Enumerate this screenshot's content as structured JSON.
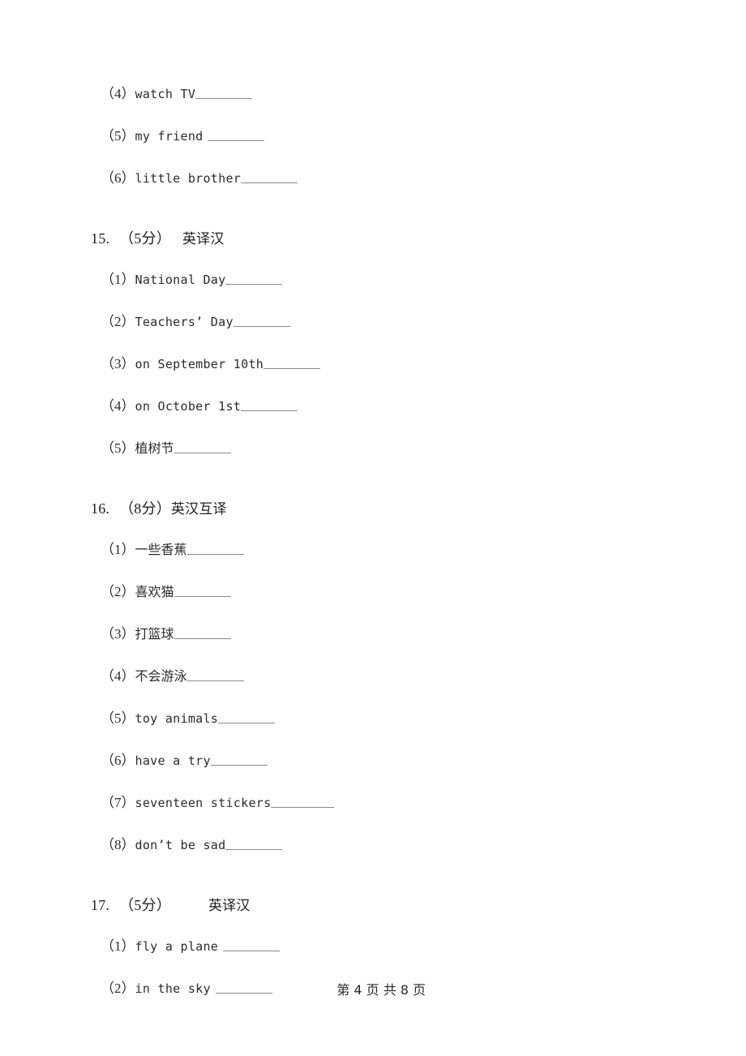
{
  "document": {
    "type": "exam-paper",
    "language": "zh-CN",
    "text_color": "#2b2b2b",
    "blank_color": "#8a8a8a",
    "background": "#ffffff"
  },
  "continued_items": [
    {
      "marker": "（4）",
      "text": "watch TV",
      "space_before_blank": false,
      "blank": "md"
    },
    {
      "marker": "（5）",
      "text": "my friend",
      "space_before_blank": true,
      "blank": "md"
    },
    {
      "marker": "（6）",
      "text": "little brother",
      "space_before_blank": false,
      "blank": "md"
    }
  ],
  "questions": [
    {
      "number": "15.",
      "score": "（5分）",
      "gap": "small",
      "title": "英译汉",
      "items": [
        {
          "marker": "（1）",
          "text": "National Day",
          "script": "en",
          "space_before_blank": false,
          "blank": "md"
        },
        {
          "marker": "（2）",
          "text": "Teachers’ Day",
          "script": "en",
          "space_before_blank": false,
          "blank": "md"
        },
        {
          "marker": "（3）",
          "text": "on September 10th",
          "script": "en",
          "space_before_blank": false,
          "blank": "md"
        },
        {
          "marker": "（4）",
          "text": "on October 1st",
          "script": "en",
          "space_before_blank": false,
          "blank": "md"
        },
        {
          "marker": "（5）",
          "text": "植树节",
          "script": "cn",
          "space_before_blank": false,
          "blank": "md"
        }
      ]
    },
    {
      "number": "16.",
      "score": "（8分）",
      "gap": "none",
      "title": "英汉互译",
      "items": [
        {
          "marker": "（1）",
          "text": "一些香蕉",
          "script": "cn",
          "space_before_blank": false,
          "blank": "md"
        },
        {
          "marker": "（2）",
          "text": "喜欢猫",
          "script": "cn",
          "space_before_blank": false,
          "blank": "md"
        },
        {
          "marker": "（3）",
          "text": "打篮球",
          "script": "cn",
          "space_before_blank": false,
          "blank": "md"
        },
        {
          "marker": "（4）",
          "text": "不会游泳",
          "script": "cn",
          "space_before_blank": false,
          "blank": "md"
        },
        {
          "marker": "（5）",
          "text": "toy animals",
          "script": "en",
          "space_before_blank": false,
          "blank": "md"
        },
        {
          "marker": "（6）",
          "text": "have a try",
          "script": "en",
          "space_before_blank": false,
          "blank": "md"
        },
        {
          "marker": "（7）",
          "text": "seventeen stickers",
          "script": "en",
          "space_before_blank": false,
          "blank": "lg"
        },
        {
          "marker": "（8）",
          "text": "don’t be sad",
          "script": "en",
          "space_before_blank": false,
          "blank": "md"
        }
      ]
    },
    {
      "number": "17.",
      "score": "（5分）",
      "gap": "large",
      "title": "英译汉",
      "items": [
        {
          "marker": "（1）",
          "text": "fly a plane",
          "script": "en",
          "space_before_blank": true,
          "blank": "md"
        },
        {
          "marker": "（2）",
          "text": "in the sky",
          "script": "en",
          "space_before_blank": true,
          "blank": "md"
        }
      ]
    }
  ],
  "footer": {
    "page_label": "第 4 页 共 8 页",
    "current_page": 4,
    "total_pages": 8
  }
}
